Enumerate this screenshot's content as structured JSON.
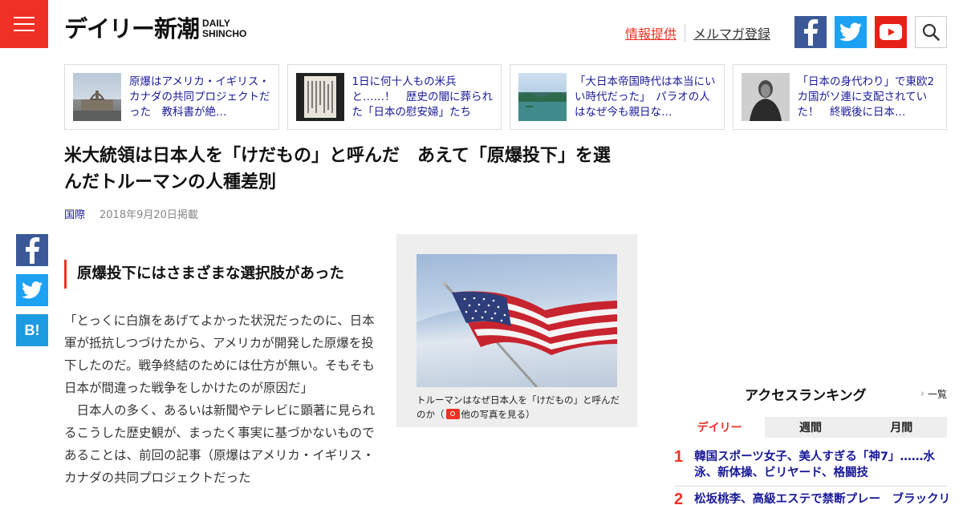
{
  "header": {
    "logo_jp_main": "デイリー",
    "logo_jp_accent": "新潮",
    "logo_en_line1": "DAILY",
    "logo_en_line2": "SHINCHO",
    "link_info": "情報提供",
    "link_mailmag": "メルマガ登録"
  },
  "related": [
    {
      "text": "原爆はアメリカ・イギリス・カナダの共同プロジェクトだった　教科書が絶…"
    },
    {
      "text": "1日に何十人もの米兵と……！　歴史の闇に葬られた「日本の慰安婦」たち"
    },
    {
      "text": "「大日本帝国時代は本当にいい時代だった」　パラオの人はなぜ今も親日な…"
    },
    {
      "text": "「日本の身代わり」で東欧2カ国がソ連に支配されていた！　終戦後に日本…"
    }
  ],
  "article": {
    "title": "米大統領は日本人を「けだもの」と呼んだ　あえて「原爆投下」を選んだトルーマンの人種差別",
    "category": "国際",
    "date": "2018年9月20日掲載",
    "subheading": "原爆投下にはさまざまな選択肢があった",
    "paragraph1": "「とっくに白旗をあげてよかった状況だったのに、日本軍が抵抗しつづけたから、アメリカが開発した原爆を投下したのだ。戦争終結のためには仕方が無い。そもそも日本が間違った戦争をしかけたのが原因だ」",
    "paragraph2": "　日本人の多く、あるいは新聞やテレビに顕著に見られるこうした歴史観が、まったく事実に基づかないものであることは、前回の記事（原爆はアメリカ・イギリス・カナダの共同プロジェクトだった",
    "figure_caption_prefix": "トルーマンはなぜ日本人を「けだもの」と呼んだのか（",
    "figure_caption_link": "他の写真を見る",
    "figure_caption_suffix": "）"
  },
  "share": {
    "hatena_label": "B!"
  },
  "ranking": {
    "title": "アクセスランキング",
    "all_link": "一覧",
    "tabs": [
      {
        "label": "デイリー",
        "active": true
      },
      {
        "label": "週間",
        "active": false
      },
      {
        "label": "月間",
        "active": false
      }
    ],
    "items": [
      {
        "rank": "1",
        "text": "韓国スポーツ女子、美人すぎる「神7」……水泳、新体操、ビリヤード、格闘技"
      },
      {
        "rank": "2",
        "text": "松坂桃李、高級エステで禁断プレー　ブラックリ"
      }
    ]
  },
  "colors": {
    "brand_red": "#ee3124",
    "link_navy": "#1a1a99",
    "facebook": "#3b5998",
    "twitter": "#1da1f2",
    "youtube": "#e62117"
  }
}
